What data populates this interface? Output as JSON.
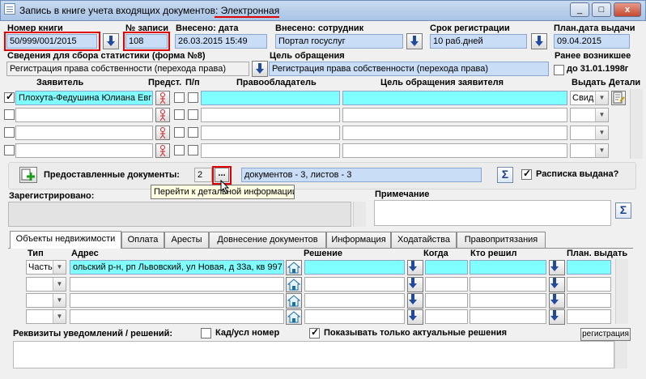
{
  "window": {
    "title_prefix": "Запись в книге учета входящих документов: ",
    "title_highlight": "Электронная",
    "min": "_",
    "max": "□",
    "close": "x"
  },
  "top": {
    "book_label": "Номер книги",
    "book_value": "50/999/001/2015",
    "rec_label": "№ записи",
    "rec_value": "108",
    "date_label": "Внесено: дата",
    "date_value": "26.03.2015 15:49",
    "emp_label": "Внесено: сотрудник",
    "emp_value": "Портал госуслуг",
    "term_label": "Срок регистрации",
    "term_value": "10 раб.дней",
    "plan_label": "План.дата выдачи",
    "plan_value": "09.04.2015"
  },
  "stats": {
    "label": "Сведения для сбора статистики (форма №8)",
    "value": "Регистрация права собственности (перехода права)"
  },
  "purpose": {
    "label": "Цель обращения",
    "value": "Регистрация права собственности (перехода права)"
  },
  "earlier": {
    "label": "Ранее возникшее",
    "check_label": "до 31.01.1998г"
  },
  "applicants": {
    "headers": {
      "applicant": "Заявитель",
      "rep": "Предст.",
      "pp": "П/п",
      "holder": "Правообладатель",
      "goal": "Цель обращения заявителя",
      "issue": "Выдать",
      "details": "Детали"
    },
    "rows": [
      {
        "name": "Плохута-Федушина Юлиана Евгр",
        "issue": "Свид"
      },
      {
        "name": "",
        "issue": ""
      },
      {
        "name": "",
        "issue": ""
      },
      {
        "name": "",
        "issue": ""
      }
    ]
  },
  "docs": {
    "label": "Предоставленные документы:",
    "count": "2",
    "dots": "...",
    "summary": "документов - 3, листов - 3",
    "tooltip": "Перейти к детальной информации",
    "receipt": "Расписка выдана?"
  },
  "registered_label": "Зарегистрировано:",
  "note_label": "Примечание",
  "tabs": [
    "Объекты недвижимости",
    "Оплата",
    "Аресты",
    "Довнесение документов",
    "Информация",
    "Ходатайства",
    "Правопритязания"
  ],
  "objects": {
    "headers": {
      "type": "Тип",
      "address": "Адрес",
      "decision": "Решение",
      "when": "Когда",
      "who": "Кто решил",
      "plan": "План. выдать"
    },
    "rows": [
      {
        "type": "Часть",
        "address": "ольский р-н, рп Львовский, ул Новая, д 33а, кв 997"
      },
      {
        "type": "",
        "address": ""
      },
      {
        "type": "",
        "address": ""
      },
      {
        "type": "",
        "address": ""
      }
    ]
  },
  "notify": {
    "label": "Реквизиты уведомлений / решений:",
    "kad_label": "Кад/усл номер",
    "actual_label": "Показывать только актуальные решения",
    "reg_button": "регистрация"
  },
  "sigma": "Σ"
}
